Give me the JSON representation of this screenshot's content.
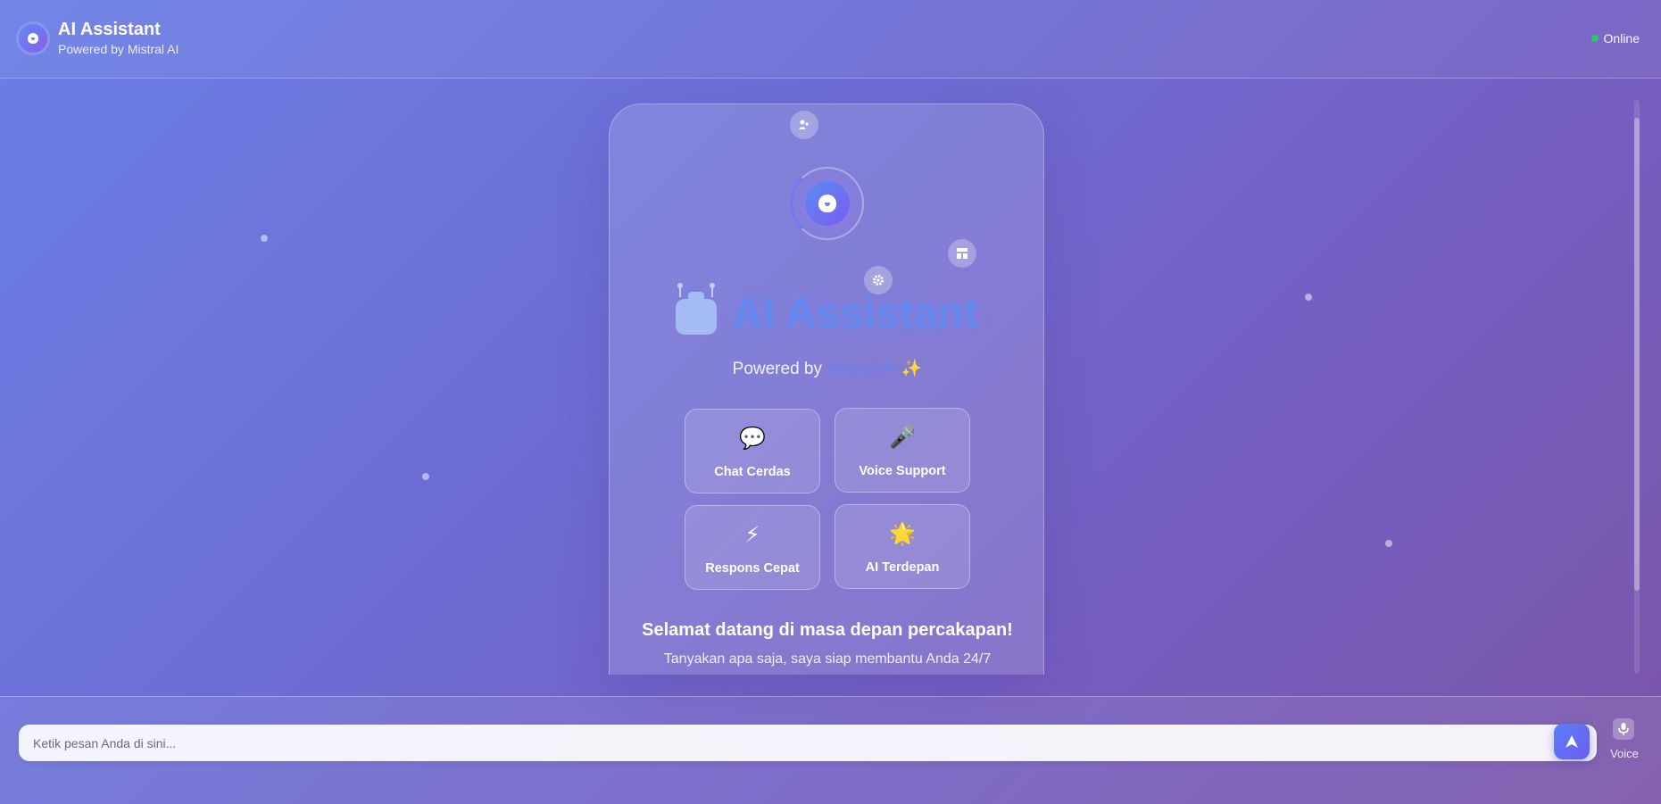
{
  "header": {
    "title": "AI Assistant",
    "subtitle": "Powered by Mistral AI",
    "status": "Online",
    "status_color": "#27c76b"
  },
  "hero": {
    "title": "AI Assistant",
    "powered_prefix": "Powered by",
    "powered_brand": "Mistral AI",
    "powered_emoji": "✨"
  },
  "features": [
    {
      "label": "Chat Cerdas",
      "icon": "💬"
    },
    {
      "label": "Voice Support",
      "icon": "🎤"
    },
    {
      "label": "Respons Cepat",
      "icon": "⚡"
    },
    {
      "label": "AI Terdepan",
      "icon": "🌟"
    }
  ],
  "welcome": {
    "title": "Selamat datang di masa depan percakapan!",
    "subtitle": "Tanyakan apa saja, saya siap membantu Anda 24/7"
  },
  "composer": {
    "placeholder": "Ketik pesan Anda di sini...",
    "voice_label": "Voice"
  },
  "colors": {
    "accent": "#5f8af2",
    "brand_text": "#6a7ff0"
  }
}
